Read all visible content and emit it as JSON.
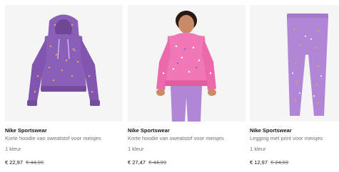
{
  "products": [
    {
      "brand": "Nike Sportswear",
      "title": "Korte hoodie van sweatstof voor meisjes",
      "colors": "1 kleur",
      "price": "€ 22,97",
      "original_price": "€ 44,99",
      "image": "purple-hoodie"
    },
    {
      "brand": "Nike Sportswear",
      "title": "Korte hoodie van sweatstof voor meisjes",
      "colors": "1 kleur",
      "price": "€ 27,47",
      "original_price": "€ 44,99",
      "image": "girl-pink-hoodie"
    },
    {
      "brand": "Nike Sportswear",
      "title": "Legging met print voor meisjes",
      "colors": "1 kleur",
      "price": "€ 12,97",
      "original_price": "€ 24,99",
      "image": "purple-leggings"
    }
  ],
  "colors": {
    "hoodie_purple": "#8a5fb8",
    "hoodie_pink": "#f178b6",
    "legging_purple": "#b286d6",
    "swoosh_print": "#e9a24c"
  }
}
